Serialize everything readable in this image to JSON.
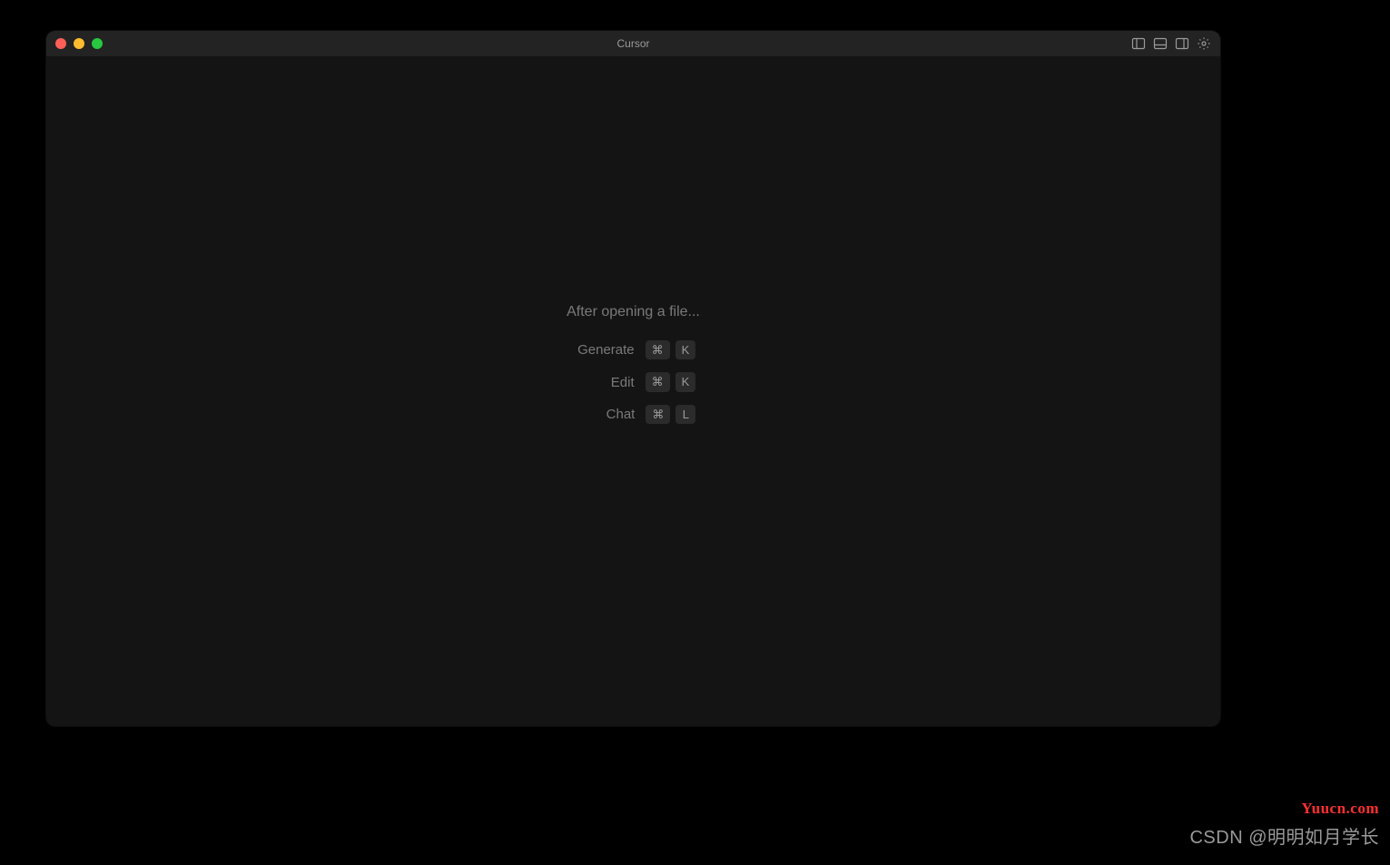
{
  "window": {
    "title": "Cursor"
  },
  "welcome": {
    "heading": "After opening a file...",
    "shortcuts": [
      {
        "label": "Generate",
        "modifier": "⌘",
        "key": "K"
      },
      {
        "label": "Edit",
        "modifier": "⌘",
        "key": "K"
      },
      {
        "label": "Chat",
        "modifier": "⌘",
        "key": "L"
      }
    ]
  },
  "watermark": {
    "red": "Yuucn.com",
    "gray": "CSDN @明明如月学长"
  }
}
